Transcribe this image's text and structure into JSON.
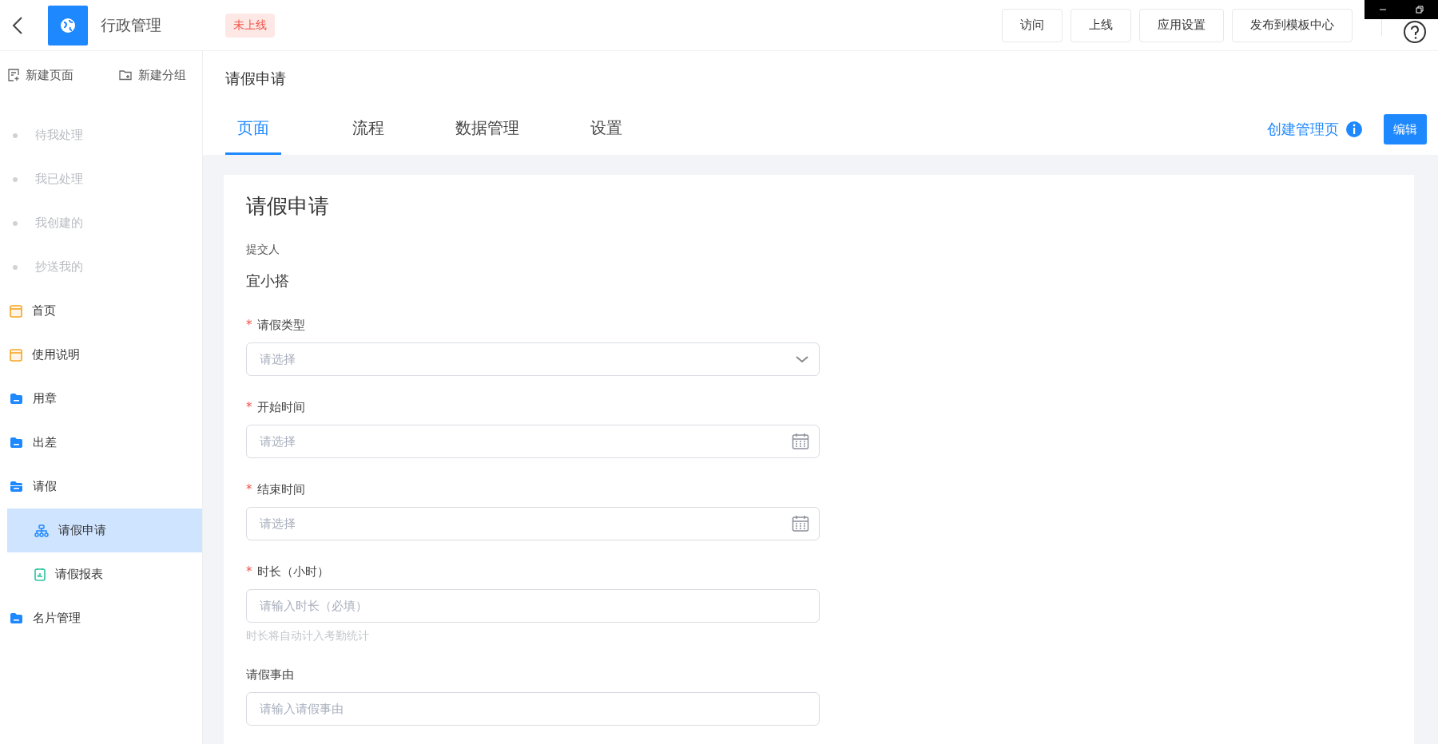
{
  "header": {
    "app_name": "行政管理",
    "status_badge": "未上线",
    "buttons": [
      "访问",
      "上线",
      "应用设置",
      "发布到模板中心"
    ]
  },
  "sidebar": {
    "actions": [
      {
        "kind": "page",
        "label": "新建页面"
      },
      {
        "kind": "group",
        "label": "新建分组"
      }
    ],
    "items": [
      {
        "kind": "dot",
        "label": "待我处理",
        "selected": false
      },
      {
        "kind": "dot",
        "label": "我已处理",
        "selected": false
      },
      {
        "kind": "dot",
        "label": "我创建的",
        "selected": false
      },
      {
        "kind": "dot",
        "label": "抄送我的",
        "selected": false
      },
      {
        "kind": "page",
        "label": "首页",
        "selected": false
      },
      {
        "kind": "page",
        "label": "使用说明",
        "selected": false
      },
      {
        "kind": "folder",
        "label": "用章",
        "expanded": false,
        "selected": false
      },
      {
        "kind": "folder",
        "label": "出差",
        "expanded": false,
        "selected": false
      },
      {
        "kind": "folder",
        "label": "请假",
        "expanded": true,
        "selected": false,
        "children": [
          {
            "kind": "flow",
            "label": "请假申请",
            "selected": true
          },
          {
            "kind": "report",
            "label": "请假报表",
            "selected": false
          }
        ]
      },
      {
        "kind": "folder",
        "label": "名片管理",
        "expanded": false,
        "selected": false
      }
    ]
  },
  "page": {
    "title": "请假申请",
    "tabs": [
      {
        "label": "页面",
        "selected": true
      },
      {
        "label": "流程",
        "selected": false
      },
      {
        "label": "数据管理",
        "selected": false
      },
      {
        "label": "设置",
        "selected": false
      }
    ],
    "create_link": "创建管理页",
    "edit_button": "编辑"
  },
  "form": {
    "title": "请假申请",
    "required_mark": "*",
    "submitter_label": "提交人",
    "submitter": "宜小搭",
    "fields": [
      {
        "kind": "select",
        "label": "请假类型",
        "required": true,
        "placeholder": "请选择"
      },
      {
        "kind": "date",
        "label": "开始时间",
        "required": true,
        "placeholder": "请选择"
      },
      {
        "kind": "date",
        "label": "结束时间",
        "required": true,
        "placeholder": "请选择"
      },
      {
        "kind": "input",
        "label": "时长（小时）",
        "required": true,
        "placeholder": "请输入时长（必填）",
        "hint": "时长将自动计入考勤统计"
      },
      {
        "kind": "textarea",
        "label": "请假事由",
        "required": false,
        "placeholder": "请输入请假事由"
      }
    ]
  }
}
